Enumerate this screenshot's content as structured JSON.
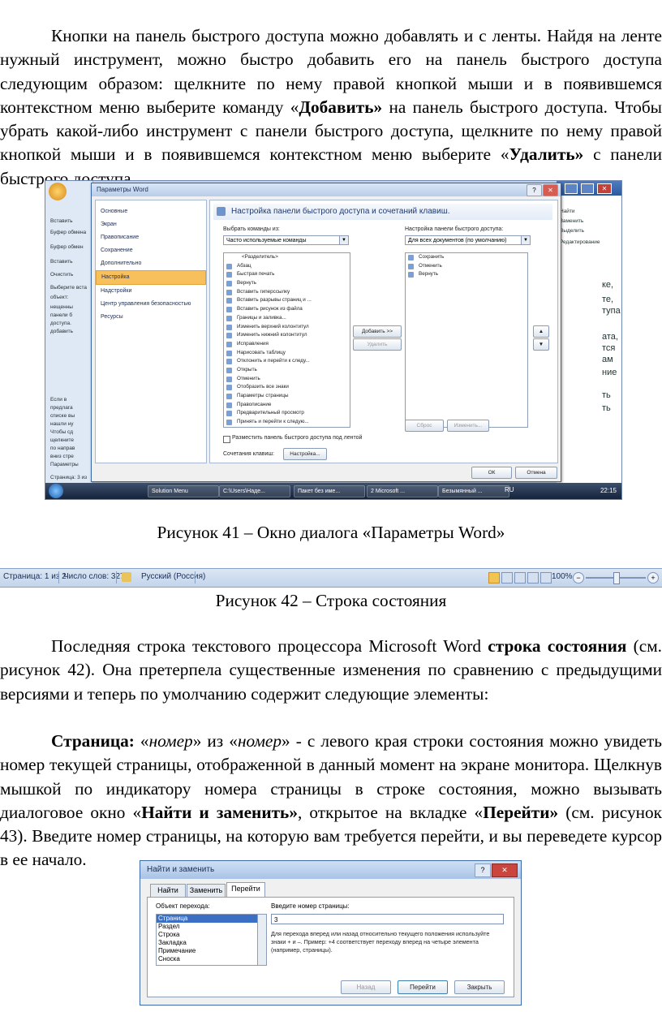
{
  "para1": {
    "text1": "Кнопки на панель быстрого доступа можно добавлять и с ленты. Найдя на ленте нужный инструмент, можно быстро добавить его на панель быстрого доступа следующим образом: щелкните по нему правой кнопкой мыши и в появившемся контекстном меню выберите команду «",
    "bold1": "Добавить»",
    "text2": " на панель быстрого доступа. Чтобы убрать какой-либо инструмент с панели быстрого доступа, щелкните по нему правой кнопкой мыши и в появившемся контекстном меню выберите «",
    "bold2": "Удалить»",
    "text3": " с панели быстрого доступа."
  },
  "fig41": {
    "caption": "Рисунок 41 – Окно диалога «Параметры Word»",
    "dialog_title": "Параметры Word",
    "nav": [
      "Основные",
      "Экран",
      "Правописание",
      "Сохранение",
      "Дополнительно",
      "Настройка",
      "Надстройки",
      "Центр управления безопасностью",
      "Ресурсы"
    ],
    "active_nav": "Настройка",
    "header": "Настройка панели быстрого доступа и сочетаний клавиш.",
    "choose_label": "Выбрать команды из:",
    "choose_value": "Часто используемые команды",
    "customize_label": "Настройка панели быстрого доступа:",
    "customize_value": "Для всех документов (по умолчанию)",
    "commands": [
      "<Разделитель>",
      "Абзац",
      "Быстрая печать",
      "Вернуть",
      "Вставить гиперссылку",
      "Вставить разрывы страниц и ...",
      "Вставить рисунок из файла",
      "Границы и заливка...",
      "Изменить верхний колонтитул",
      "Изменить нижний колонтитул",
      "Исправления",
      "Нарисовать таблицу",
      "Отклонить и перейти к следу...",
      "Открыть",
      "Отменить",
      "Отобразить все знаки",
      "Параметры страницы",
      "Правописание",
      "Предварительный просмотр",
      "Принять и перейти к следую..."
    ],
    "toolbar_items": [
      "Сохранить",
      "Отменить",
      "Вернуть"
    ],
    "add_btn": "Добавить >>",
    "remove_btn": "Удалить",
    "reset_btn": "Сброс",
    "modify_btn": "Изменить...",
    "checkbox_label": "Разместить панель быстрого доступа под лентой",
    "shortcuts_label": "Сочетания клавиш:",
    "shortcuts_btn": "Настройка...",
    "ok": "ОК",
    "cancel": "Отмена",
    "word_left": [
      "Вставить",
      "Буфер обмена",
      "Буфер обмен",
      "Вставить",
      "Очистить",
      "Выберите вста",
      "объект:",
      "нещенны",
      "панели б",
      "доступа.",
      "добавить",
      "Если в",
      "предлага",
      "списке вы",
      "нашли ну",
      "Чтобы сд",
      "щелкните",
      "по направ",
      "вниз стре",
      "Параметры",
      "Страница: 3 из"
    ],
    "word_right": [
      "Найти",
      "Заменить",
      "Выделить",
      "Редактирование",
      "ке,",
      "те,",
      "тупа",
      "ата,",
      "тся",
      "ам",
      "ние",
      "ть",
      "ть"
    ],
    "taskbar": [
      "Solution Menu",
      "C:\\Users\\Наде...",
      "Пакет без име...",
      "2 Microsoft ...",
      "Безымянный ..."
    ],
    "lang": "RU",
    "clock": "22:15"
  },
  "fig42": {
    "caption": "Рисунок 42 – Строка состояния",
    "page": "Страница: 1 из 2",
    "words": "Число слов: 327",
    "lang": "Русский (Россия)",
    "zoom": "100%"
  },
  "para2": {
    "text1": "Последняя строка текстового процессора Microsoft Word ",
    "bold1": "строка состояния",
    "text2": " (см. рисунок 42). Она претерпела существенные изменения по сравнению с предыдущими версиями и теперь по умолчанию содержит следующие элементы:"
  },
  "para3": {
    "bold1": "Страница:",
    "text1": " «",
    "ital1": "номер",
    "text2": "» из «",
    "ital2": "номер",
    "text3": "» - с левого края строки состояния можно увидеть номер текущей страницы, отображенной в данный момент на экране монитора. Щелкнув мышкой по индикатору номера страницы в строке состояния, можно вызывать диалоговое окно «",
    "bold2": "Найти и заменить»",
    "text4": ", открытое на вкладке «",
    "bold3": "Перейти»",
    "text5": " (см. рисунок 43). Введите номер страницы, на которую вам требуется перейти, и вы переведете курсор в ее начало."
  },
  "fig43": {
    "title": "Найти и заменить",
    "tabs": [
      "Найти",
      "Заменить",
      "Перейти"
    ],
    "object_label": "Объект перехода:",
    "objects": [
      "Страница",
      "Раздел",
      "Строка",
      "Закладка",
      "Примечание",
      "Сноска"
    ],
    "page_label": "Введите номер страницы:",
    "page_value": "3",
    "hint": "Для перехода вперед или назад относительно текущего положения используйте знаки + и –. Пример: +4 соответствует переходу вперед на четыре элемента (например, страницы).",
    "back_btn": "Назад",
    "go_btn": "Перейти",
    "close_btn": "Закрыть"
  }
}
